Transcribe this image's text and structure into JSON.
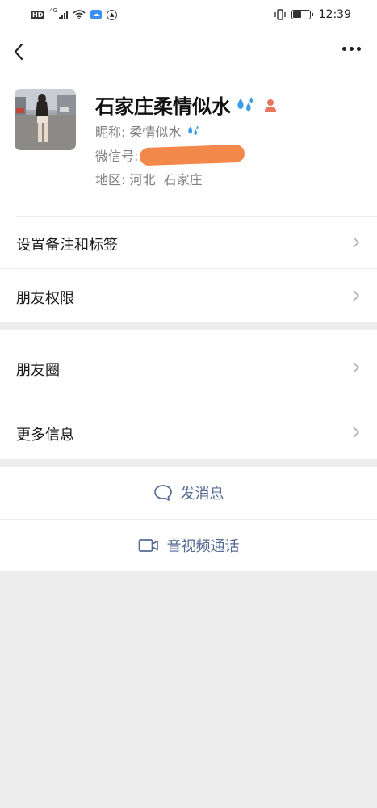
{
  "status_bar": {
    "hd": "HD",
    "network": "4G",
    "time": "12:39",
    "icons": [
      "hd-icon",
      "signal-icon",
      "wifi-icon",
      "cloud-icon",
      "app-icon",
      "vibrate-icon",
      "battery-icon"
    ],
    "battery_level": 0.5
  },
  "nav": {
    "back_icon": "chevron-left-icon",
    "more_icon": "more-dots-icon"
  },
  "profile": {
    "name": "石家庄柔情似水",
    "nickname_label": "昵称:",
    "nickname": "柔情似水",
    "wechat_id_label": "微信号:",
    "region_label": "地区:",
    "region": "河北  石家庄"
  },
  "menu": {
    "remark_tags": "设置备注和标签",
    "friend_permissions": "朋友权限",
    "moments": "朋友圈",
    "more_info": "更多信息"
  },
  "actions": {
    "send_message": "发消息",
    "video_call": "音视频通话"
  },
  "colors": {
    "accent": "#576b95",
    "background": "#ededed",
    "redaction": "#f2884a",
    "drops": "#3a9de8",
    "person": "#e8765c"
  }
}
